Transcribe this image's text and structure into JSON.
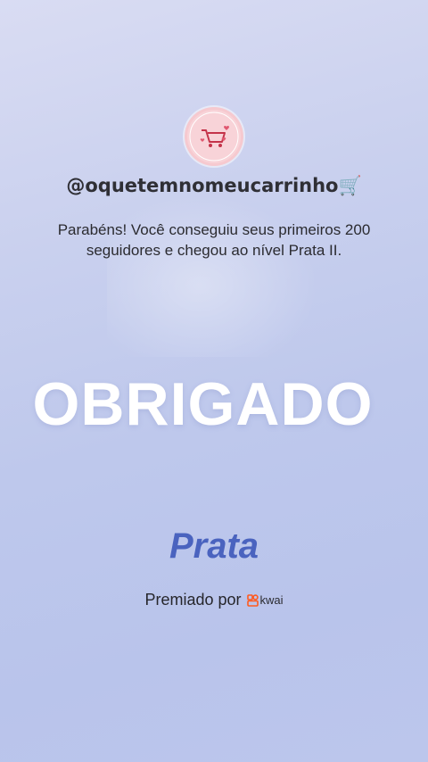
{
  "profile": {
    "handle": "@oquetemnomeucarrinho🛒",
    "avatar_text": "O que tem no meu carrinho"
  },
  "message": "Parabéns! Você conseguiu seus primeiros 200 seguidores e chegou ao nível Prata II.",
  "headline": "OBRIGADO",
  "tier": "Prata",
  "award": {
    "label": "Premiado por",
    "brand": "kwai"
  },
  "colors": {
    "tier": "#4a63bf",
    "brand_logo": "#ff5a1f"
  }
}
